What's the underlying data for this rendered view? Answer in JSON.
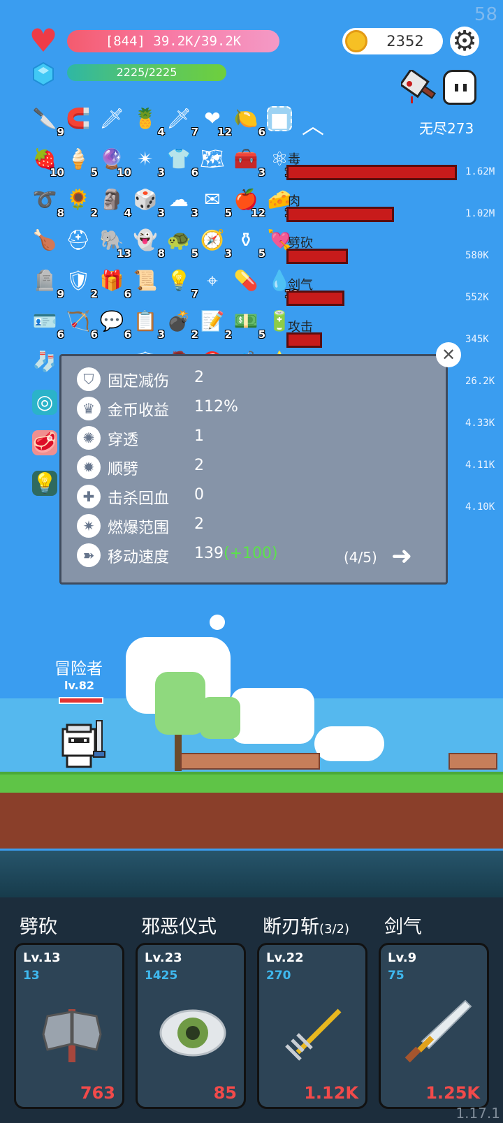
{
  "fps": "58",
  "hud": {
    "hp_text": "[844] 39.2K/39.2K",
    "mp_text": "2225/2225",
    "coins": "2352",
    "mode_label": "无尽273"
  },
  "items": [
    [
      {
        "icon": "scalpel",
        "count": "9"
      },
      {
        "icon": "magnet",
        "count": ""
      },
      {
        "icon": "sword",
        "count": ""
      },
      {
        "icon": "pineapple",
        "count": "4"
      },
      {
        "icon": "dagger",
        "count": "7"
      },
      {
        "icon": "heart",
        "count": "12"
      },
      {
        "icon": "lemon",
        "count": "6"
      },
      {
        "icon": "empty-slot",
        "count": ""
      }
    ],
    [
      {
        "icon": "strawberry",
        "count": "10"
      },
      {
        "icon": "ice-cream",
        "count": "5"
      },
      {
        "icon": "crystal-ball",
        "count": "10"
      },
      {
        "icon": "spiked-mace",
        "count": "3"
      },
      {
        "icon": "shirt",
        "count": "6"
      },
      {
        "icon": "map",
        "count": ""
      },
      {
        "icon": "toolbox",
        "count": "3"
      },
      {
        "icon": "molecule",
        "count": "13"
      }
    ],
    [
      {
        "icon": "noose",
        "count": "8"
      },
      {
        "icon": "sunflower",
        "count": "2"
      },
      {
        "icon": "ghost-idol",
        "count": "4"
      },
      {
        "icon": "dice",
        "count": "3"
      },
      {
        "icon": "cloud",
        "count": "3"
      },
      {
        "icon": "envelope",
        "count": "5"
      },
      {
        "icon": "apple",
        "count": "12"
      },
      {
        "icon": "cheese",
        "count": "10"
      }
    ],
    [
      {
        "icon": "drumstick",
        "count": ""
      },
      {
        "icon": "viking-helmet",
        "count": ""
      },
      {
        "icon": "elephant",
        "count": "13"
      },
      {
        "icon": "ghost",
        "count": "8"
      },
      {
        "icon": "turtle-shell",
        "count": "5"
      },
      {
        "icon": "compass",
        "count": "3"
      },
      {
        "icon": "cauldron",
        "count": "5"
      },
      {
        "icon": "heart-pin",
        "count": "5"
      }
    ],
    [
      {
        "icon": "tombstone",
        "count": "9"
      },
      {
        "icon": "shield",
        "count": "2"
      },
      {
        "icon": "gift",
        "count": "6"
      },
      {
        "icon": "scroll",
        "count": ""
      },
      {
        "icon": "light-bulb",
        "count": "7"
      },
      {
        "icon": "crosshair",
        "count": ""
      },
      {
        "icon": "capsule",
        "count": ""
      },
      {
        "icon": "water-drop",
        "count": "10"
      }
    ],
    [
      {
        "icon": "card",
        "count": "6"
      },
      {
        "icon": "bow",
        "count": "6"
      },
      {
        "icon": "speech-bubble",
        "count": "6"
      },
      {
        "icon": "clipboard",
        "count": "3"
      },
      {
        "icon": "grenade",
        "count": "2"
      },
      {
        "icon": "note",
        "count": "2"
      },
      {
        "icon": "cash",
        "count": "5"
      },
      {
        "icon": "battery",
        "count": ""
      }
    ],
    [
      {
        "icon": "sock",
        "count": ""
      },
      {
        "icon": "arrows",
        "count": ""
      },
      {
        "icon": "bat",
        "count": ""
      },
      {
        "icon": "badge",
        "count": ""
      },
      {
        "icon": "zombie",
        "count": ""
      },
      {
        "icon": "target",
        "count": ""
      },
      {
        "icon": "chest",
        "count": ""
      },
      {
        "icon": "star",
        "count": ""
      }
    ],
    [
      {
        "icon": "vortex",
        "count": ""
      }
    ],
    [
      {
        "icon": "meat",
        "count": ""
      }
    ],
    [
      {
        "icon": "bulb-card",
        "count": ""
      }
    ]
  ],
  "damage": [
    {
      "label": "毒",
      "value": "1.62M",
      "ratio": 1.0
    },
    {
      "label": "肉",
      "value": "1.02M",
      "ratio": 0.63
    },
    {
      "label": "劈砍",
      "value": "580K",
      "ratio": 0.36
    },
    {
      "label": "剑气",
      "value": "552K",
      "ratio": 0.34
    },
    {
      "label": "攻击",
      "value": "345K",
      "ratio": 0.21
    },
    {
      "label": "",
      "value": "26.2K",
      "ratio": 0
    },
    {
      "label": "",
      "value": "4.33K",
      "ratio": 0
    },
    {
      "label": "",
      "value": "4.11K",
      "ratio": 0
    },
    {
      "label": "",
      "value": "4.10K",
      "ratio": 0
    }
  ],
  "stats": [
    {
      "icon": "shield-icon",
      "label": "固定减伤",
      "value": "2",
      "bonus": ""
    },
    {
      "icon": "coin-crown-icon",
      "label": "金币收益",
      "value": "112%",
      "bonus": ""
    },
    {
      "icon": "pierce-ring-icon",
      "label": "穿透",
      "value": "1",
      "bonus": ""
    },
    {
      "icon": "chop-ring-icon",
      "label": "顺劈",
      "value": "2",
      "bonus": ""
    },
    {
      "icon": "heal-drop-icon",
      "label": "击杀回血",
      "value": "0",
      "bonus": ""
    },
    {
      "icon": "burst-icon",
      "label": "燃爆范围",
      "value": "2",
      "bonus": ""
    },
    {
      "icon": "boot-icon",
      "label": "移动速度",
      "value": "139",
      "bonus": "(+100)"
    }
  ],
  "panel": {
    "page": "(4/5)"
  },
  "player": {
    "name": "冒险者",
    "level": "lv.82"
  },
  "skills": [
    {
      "name": "劈砍",
      "sub": "",
      "lv": "Lv.13",
      "cost": "13",
      "dmg": "763",
      "art": "axe"
    },
    {
      "name": "邪恶仪式",
      "sub": "",
      "lv": "Lv.23",
      "cost": "1425",
      "dmg": "85",
      "art": "eye"
    },
    {
      "name": "断刃斩",
      "sub": "(3/2)",
      "lv": "Lv.22",
      "cost": "270",
      "dmg": "1.12K",
      "art": "trident"
    },
    {
      "name": "剑气",
      "sub": "",
      "lv": "Lv.9",
      "cost": "75",
      "dmg": "1.25K",
      "art": "sword"
    }
  ],
  "version": "1.17.1"
}
